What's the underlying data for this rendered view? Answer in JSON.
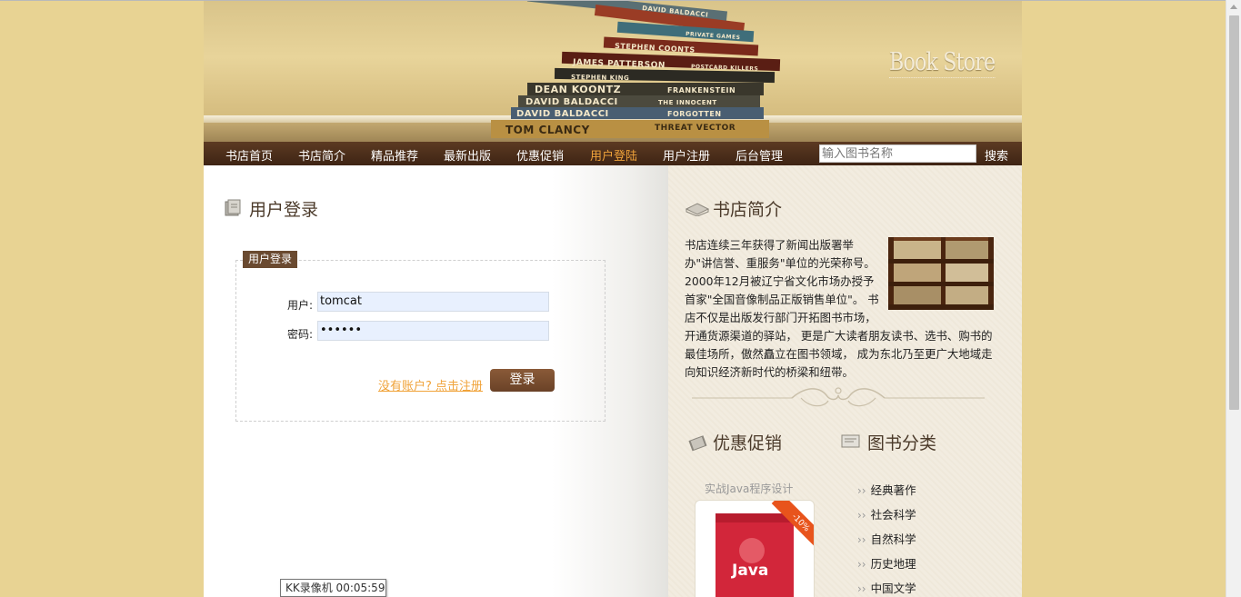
{
  "header": {
    "brand": "Book Store",
    "book_spines": [
      "DAVID BALDACCI",
      "PRIVATE GAMES",
      "STEPHEN COONTS",
      "JAMES PATTERSON",
      "POSTCARD KILLERS",
      "STEPHEN KING",
      "DEAN KOONTZ",
      "FRANKENSTEIN",
      "DAVID BALDACCI",
      "THE INNOCENT",
      "DAVID BALDACCI",
      "FORGOTTEN",
      "TOM CLANCY",
      "THREAT VECTOR"
    ]
  },
  "nav": {
    "items": [
      "书店首页",
      "书店简介",
      "精品推荐",
      "最新出版",
      "优惠促销",
      "用户登陆",
      "用户注册",
      "后台管理"
    ],
    "active_index": 5,
    "search_placeholder": "输入图书名称",
    "search_label": "搜索"
  },
  "main": {
    "title": "用户登录",
    "login": {
      "legend": "用户登录",
      "user_label": "用户:",
      "user_value": "tomcat",
      "password_label": "密码:",
      "password_value": "••••••",
      "register_link": "没有账户? 点击注册",
      "submit_label": "登录"
    }
  },
  "sidebar": {
    "intro_title": "书店简介",
    "intro_text": "书店连续三年获得了新闻出版署举办\"讲信誉、重服务\"单位的光荣称号。 2000年12月被辽宁省文化市场办授予首家\"全国音像制品正版销售单位\"。 书店不仅是出版发行部门开拓图书市场，开通货源渠道的驿站， 更是广大读者朋友读书、选书、购书的最佳场所，傲然矗立在图书领域， 成为东北乃至更广大地域走向知识经济新时代的桥梁和纽带。",
    "promo_title": "优惠促销",
    "category_title": "图书分类",
    "promo_book": {
      "title": "实战Java程序设计",
      "discount": "-10%",
      "cover_text": "Java"
    },
    "categories": [
      "经典著作",
      "社会科学",
      "自然科学",
      "历史地理",
      "中国文学"
    ]
  },
  "overlay": {
    "recorder": "KK录像机 00:05:59"
  },
  "colors": {
    "page_bg": "#e8d393",
    "nav_bg": "#4a2c1a",
    "nav_active": "#f0a33a",
    "legend_bg": "#6a4a30",
    "button_bg": "#7a4e30",
    "link": "#f0a33a"
  }
}
